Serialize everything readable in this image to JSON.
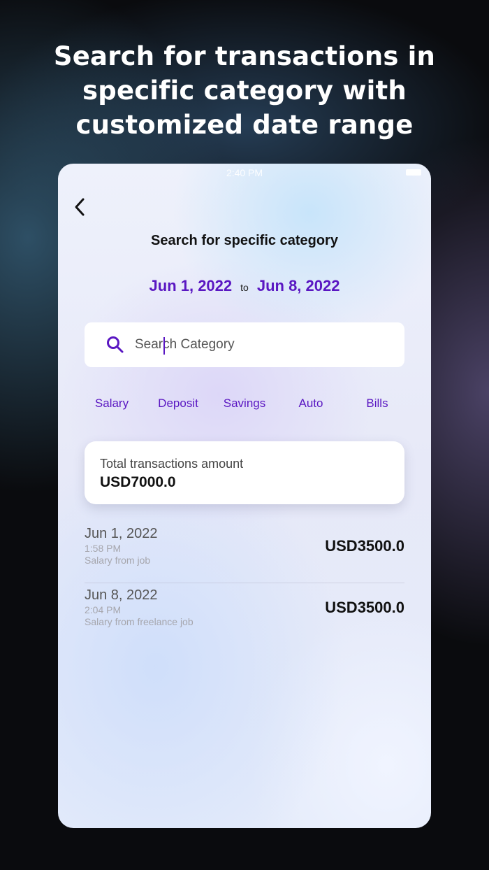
{
  "headline": {
    "line1": "Search for transactions in",
    "line2": "specific category with",
    "line3": "customized date range"
  },
  "status_bar": {
    "time": "2:40 PM"
  },
  "screen": {
    "title": "Search for specific category",
    "date_from": "Jun 1, 2022",
    "date_separator": "to",
    "date_to": "Jun 8, 2022",
    "search": {
      "placeholder": "Search Category",
      "value": ""
    },
    "categories": [
      "Salary",
      "Deposit",
      "Savings",
      "Auto",
      "Bills"
    ],
    "total": {
      "label": "Total transactions amount",
      "value": "USD7000.0"
    },
    "transactions": [
      {
        "date": "Jun 1, 2022",
        "time": "1:58 PM",
        "description": "Salary from job",
        "amount": "USD3500.0"
      },
      {
        "date": "Jun 8, 2022",
        "time": "2:04 PM",
        "description": "Salary from freelance job",
        "amount": "USD3500.0"
      }
    ]
  },
  "colors": {
    "accent": "#5a17c2",
    "text_primary": "#111111",
    "text_muted": "#a6a6ad"
  },
  "icons": {
    "back": "chevron-left-icon",
    "search": "search-icon",
    "battery": "battery-icon"
  }
}
